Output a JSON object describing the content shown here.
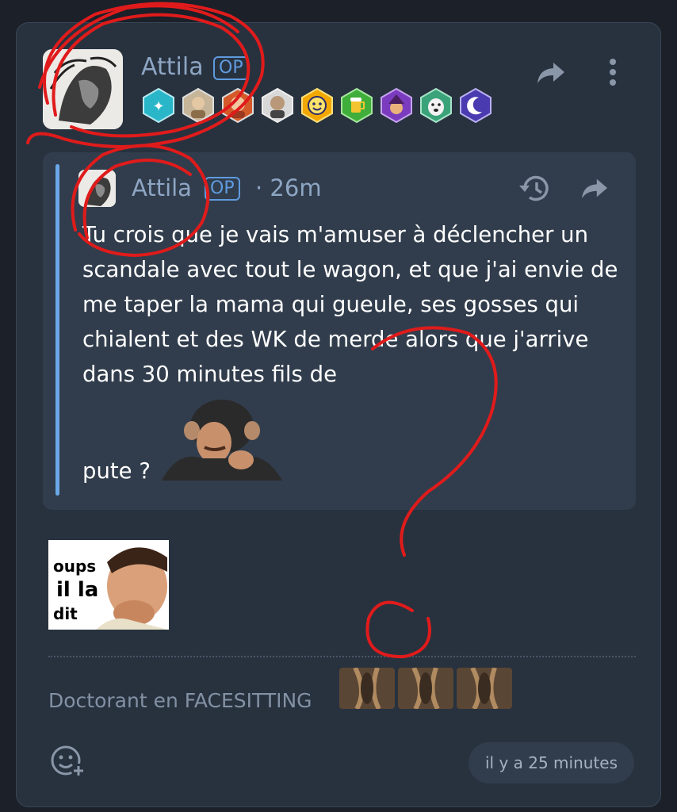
{
  "post": {
    "author": "Attila",
    "op_label": "OP",
    "badges": [
      "stars-badge",
      "portrait-badge-1",
      "portrait-badge-2",
      "portrait-badge-3",
      "smiley-badge",
      "beer-badge",
      "wizard-badge",
      "dog-badge",
      "moon-badge"
    ],
    "quote": {
      "author": "Attila",
      "op_label": "OP",
      "time": "· 26m",
      "text": "Tu crois que je vais m'amuser à déclencher un scandale avec tout le wagon, et que j'ai envie de me taper la mama qui gueule, ses gosses qui chialent et des WK de merde alors que j'arrive dans 30 minutes fils de",
      "text_end": "pute ?"
    },
    "sticker_text": [
      "oups",
      "il la",
      "dit"
    ],
    "signature": "Doctorant en FACESITTING",
    "timestamp": "il y a 25 minutes"
  },
  "colors": {
    "background": "#1b2029",
    "card": "#28323f",
    "accent": "#6aa8e8",
    "username": "#8ea6c4",
    "scribble": "#e01b1b"
  }
}
